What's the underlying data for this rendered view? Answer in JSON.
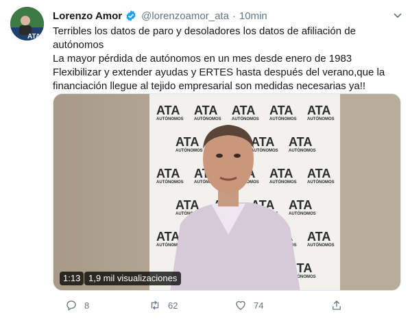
{
  "user": {
    "name": "Lorenzo Amor",
    "handle": "@lorenzoamor_ata",
    "separator": "·",
    "time": "10min",
    "avatar_text": "ATA"
  },
  "tweet": {
    "lines": [
      "Terribles los datos de paro y desoladores los datos de afiliación de",
      "autónomos",
      "La mayor pérdida de autónomos en un mes desde enero de 1983",
      "Flexibilizar y extender ayudas y ERTES hasta después del verano,que la",
      "financiación llegue al tejido empresarial son medidas necesarias ya!!"
    ]
  },
  "video": {
    "duration": "1:13",
    "views": "1,9 mil visualizaciones",
    "backdrop_logo": "ATA",
    "backdrop_sub": "AUTÓNOMOS"
  },
  "actions": {
    "reply_count": "8",
    "retweet_count": "62",
    "like_count": "74"
  },
  "colors": {
    "text": "#14171a",
    "muted": "#657786",
    "verified": "#1da1f2"
  }
}
